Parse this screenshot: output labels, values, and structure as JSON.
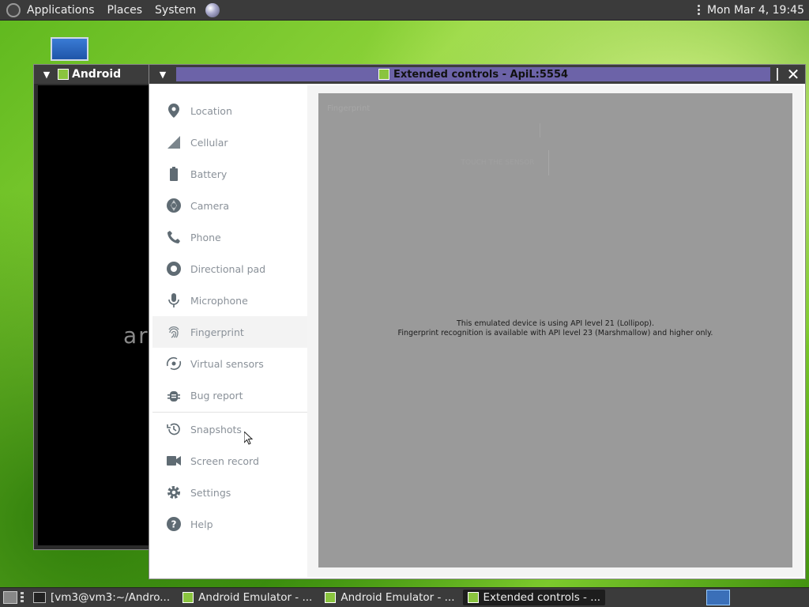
{
  "top_panel": {
    "applications": "Applications",
    "places": "Places",
    "system": "System",
    "clock": "Mon Mar  4, 19:45"
  },
  "bg_window": {
    "title": "Android",
    "screen_text": "ar"
  },
  "dialog": {
    "title": "Extended controls - ApiL:5554",
    "sidebar": [
      {
        "label": "Location",
        "icon": "location-pin-icon"
      },
      {
        "label": "Cellular",
        "icon": "cellular-signal-icon"
      },
      {
        "label": "Battery",
        "icon": "battery-icon"
      },
      {
        "label": "Camera",
        "icon": "camera-aperture-icon"
      },
      {
        "label": "Phone",
        "icon": "phone-icon"
      },
      {
        "label": "Directional pad",
        "icon": "dpad-icon"
      },
      {
        "label": "Microphone",
        "icon": "microphone-icon"
      },
      {
        "label": "Fingerprint",
        "icon": "fingerprint-icon"
      },
      {
        "label": "Virtual sensors",
        "icon": "virtual-sensors-icon"
      },
      {
        "label": "Bug report",
        "icon": "bug-icon"
      },
      {
        "label": "Snapshots",
        "icon": "history-icon"
      },
      {
        "label": "Screen record",
        "icon": "videocam-icon"
      },
      {
        "label": "Settings",
        "icon": "gear-icon"
      },
      {
        "label": "Help",
        "icon": "help-icon"
      }
    ],
    "active_item": "Fingerprint",
    "fingerprint": {
      "ghost_title": "Fingerprint",
      "touch_button": "TOUCH THE SENSOR",
      "message_line1": "This emulated device is using API level 21 (Lollipop).",
      "message_line2": "Fingerprint recognition is available with API level 23 (Marshmallow) and higher only."
    }
  },
  "taskbar": {
    "items": [
      {
        "label": "[vm3@vm3:~/Andro...",
        "icon": "terminal-icon"
      },
      {
        "label": "Android Emulator - ...",
        "icon": "android-emulator-icon"
      },
      {
        "label": "Android Emulator - ...",
        "icon": "android-emulator-icon"
      },
      {
        "label": "Extended controls - ...",
        "icon": "android-emulator-icon"
      }
    ]
  },
  "colors": {
    "title_bar_active": "#6c63a8",
    "panel_gray": "#9a9a9a",
    "sidebar_text": "#8a9199",
    "app_icon_green": "#8ac43f"
  }
}
